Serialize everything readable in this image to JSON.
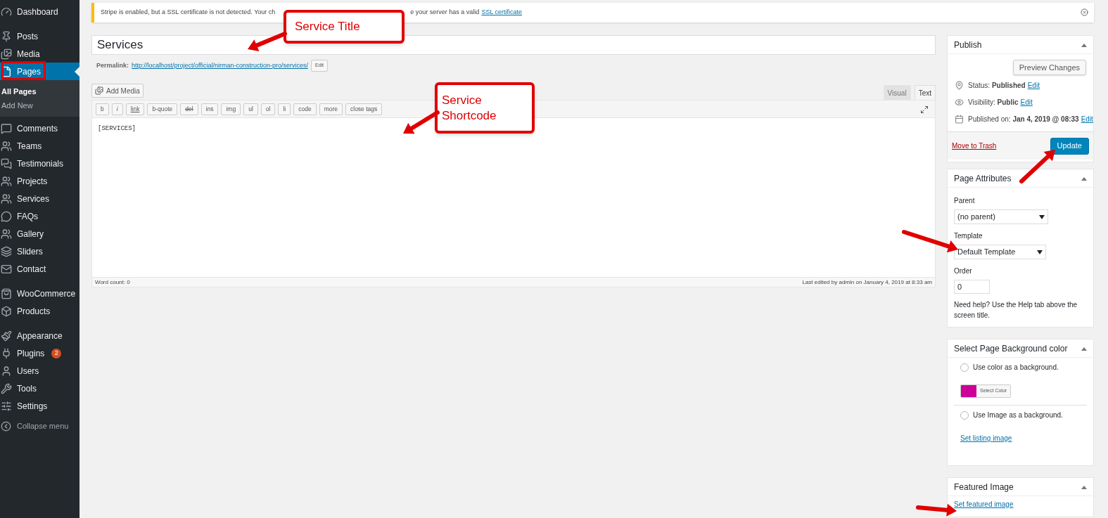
{
  "sidebar": {
    "groups": [
      [
        {
          "label": "Dashboard",
          "selected": false
        }
      ],
      [
        {
          "label": "Posts",
          "selected": false
        },
        {
          "label": "Media",
          "selected": false
        },
        {
          "label": "Pages",
          "selected": true,
          "children": [
            {
              "label": "All Pages",
              "selected": true
            },
            {
              "label": "Add New",
              "selected": false
            }
          ]
        },
        {
          "label": "Comments",
          "selected": false
        },
        {
          "label": "Teams",
          "selected": false
        },
        {
          "label": "Testimonials",
          "selected": false
        },
        {
          "label": "Projects",
          "selected": false
        },
        {
          "label": "Services",
          "selected": false
        },
        {
          "label": "FAQs",
          "selected": false
        },
        {
          "label": "Gallery",
          "selected": false
        },
        {
          "label": "Sliders",
          "selected": false
        },
        {
          "label": "Contact",
          "selected": false
        }
      ],
      [
        {
          "label": "WooCommerce",
          "selected": false
        },
        {
          "label": "Products",
          "selected": false
        }
      ],
      [
        {
          "label": "Appearance",
          "selected": false
        },
        {
          "label": "Plugins",
          "selected": false,
          "badge": "2"
        },
        {
          "label": "Users",
          "selected": false
        },
        {
          "label": "Tools",
          "selected": false
        },
        {
          "label": "Settings",
          "selected": false
        }
      ]
    ],
    "collapse": "Collapse menu"
  },
  "notice": {
    "text_before": "Stripe is enabled, but a SSL certificate is not detected. Your ch",
    "text_after": "e your server has a valid",
    "link": "SSL certificate"
  },
  "title_field": {
    "value": "Services"
  },
  "permalink": {
    "label": "Permalink:",
    "url": "http://localhost/project/official/nirman-construction-pro/services/",
    "edit": "Edit"
  },
  "editor": {
    "add_media": "Add Media",
    "tabs": [
      {
        "label": "Visual",
        "selected": false
      },
      {
        "label": "Text",
        "selected": true
      }
    ],
    "quicktags": [
      {
        "label": "b",
        "kind": "plain"
      },
      {
        "label": "i",
        "kind": "italic"
      },
      {
        "label": "link",
        "kind": "underline"
      },
      {
        "label": "b-quote",
        "kind": "plain"
      },
      {
        "label": "del",
        "kind": "strike"
      },
      {
        "label": "ins",
        "kind": "plain"
      },
      {
        "label": "img",
        "kind": "plain"
      },
      {
        "label": "ul",
        "kind": "plain"
      },
      {
        "label": "ol",
        "kind": "plain"
      },
      {
        "label": "li",
        "kind": "plain"
      },
      {
        "label": "code",
        "kind": "plain"
      },
      {
        "label": "more",
        "kind": "plain"
      },
      {
        "label": "close tags",
        "kind": "plain"
      }
    ],
    "content": "[SERVICES]",
    "word_count": "Word count: 0",
    "last_edited": "Last edited by admin on January 4, 2019 at 8:33 am"
  },
  "publish": {
    "title": "Publish",
    "preview": "Preview Changes",
    "rows": [
      {
        "kind": "status",
        "text": "Status: **Published**",
        "edit": "Edit"
      },
      {
        "kind": "visibility",
        "text": "Visibility: **Public**",
        "edit": "Edit"
      },
      {
        "kind": "date",
        "text": "Published on: **Jan 4, 2019 @ 08:33**",
        "edit": "Edit"
      }
    ],
    "trash": "Move to Trash",
    "update": "Update"
  },
  "page_attributes": {
    "title": "Page Attributes",
    "parent_label": "Parent",
    "parent_value": "(no parent)",
    "template_label": "Template",
    "template_value": "Default Template",
    "order_label": "Order",
    "order_value": "0",
    "help": "Need help? Use the Help tab above the screen title."
  },
  "background": {
    "title": "Select Page Background color",
    "options": [
      {
        "label": "Use color as a background.",
        "checked": false
      },
      {
        "label": "Use Image as a background.",
        "checked": false
      }
    ],
    "color": "#cc0099",
    "select_color": "Select Color",
    "listing_link": "Set listing image"
  },
  "featured": {
    "title": "Featured Image",
    "link": "Set featured image"
  },
  "annotations": [
    {
      "text": "Service Title"
    },
    {
      "text": "Service Shortcode"
    }
  ]
}
